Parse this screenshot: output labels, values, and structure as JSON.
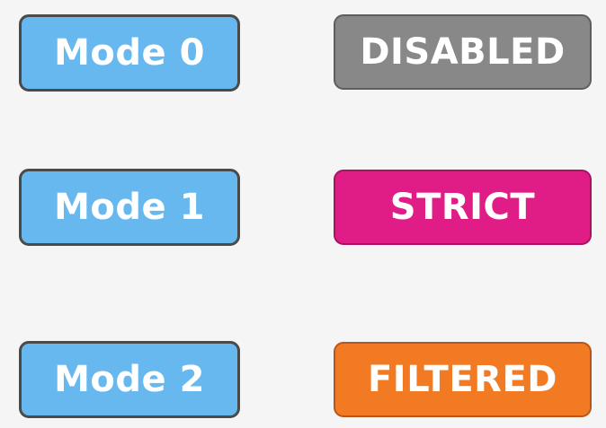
{
  "modes": [
    {
      "label": "Mode 0"
    },
    {
      "label": "Mode 1"
    },
    {
      "label": "Mode 2"
    }
  ],
  "states": [
    {
      "label": "DISABLED",
      "color": "#888888",
      "border": "#5e5e5e"
    },
    {
      "label": "STRICT",
      "color": "#e01c86",
      "border": "#a8125f"
    },
    {
      "label": "FILTERED",
      "color": "#f27a22",
      "border": "#b8561a"
    }
  ]
}
